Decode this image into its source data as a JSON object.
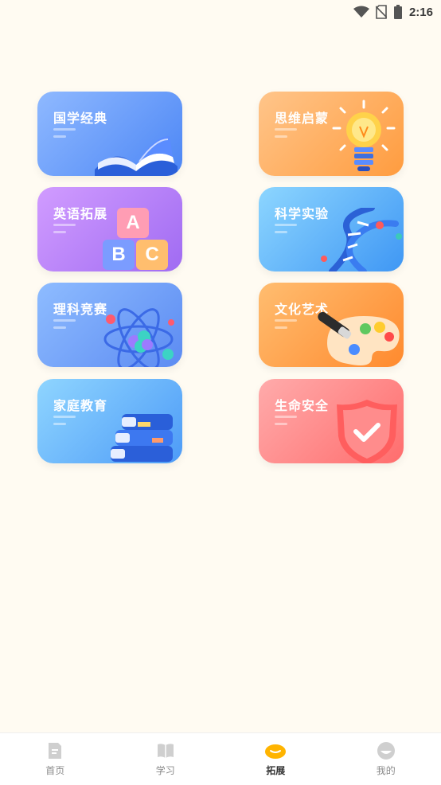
{
  "status_bar": {
    "time": "2:16"
  },
  "cards": [
    {
      "title": "国学经典",
      "icon": "book-icon"
    },
    {
      "title": "思维启蒙",
      "icon": "lightbulb-icon"
    },
    {
      "title": "英语拓展",
      "icon": "abc-blocks-icon"
    },
    {
      "title": "科学实验",
      "icon": "dna-icon"
    },
    {
      "title": "理科竞赛",
      "icon": "atom-icon"
    },
    {
      "title": "文化艺术",
      "icon": "palette-icon"
    },
    {
      "title": "家庭教育",
      "icon": "books-stack-icon"
    },
    {
      "title": "生命安全",
      "icon": "shield-icon"
    }
  ],
  "abc_letters": {
    "a": "A",
    "b": "B",
    "c": "C"
  },
  "tabbar": {
    "items": [
      {
        "label": "首页",
        "icon": "home-icon"
      },
      {
        "label": "学习",
        "icon": "book-open-icon"
      },
      {
        "label": "拓展",
        "icon": "expand-icon",
        "active": true
      },
      {
        "label": "我的",
        "icon": "profile-icon"
      }
    ]
  },
  "colors": {
    "active_tab": "#ffb400",
    "inactive_icon": "#cfcfcf",
    "background": "#fffbf2"
  }
}
